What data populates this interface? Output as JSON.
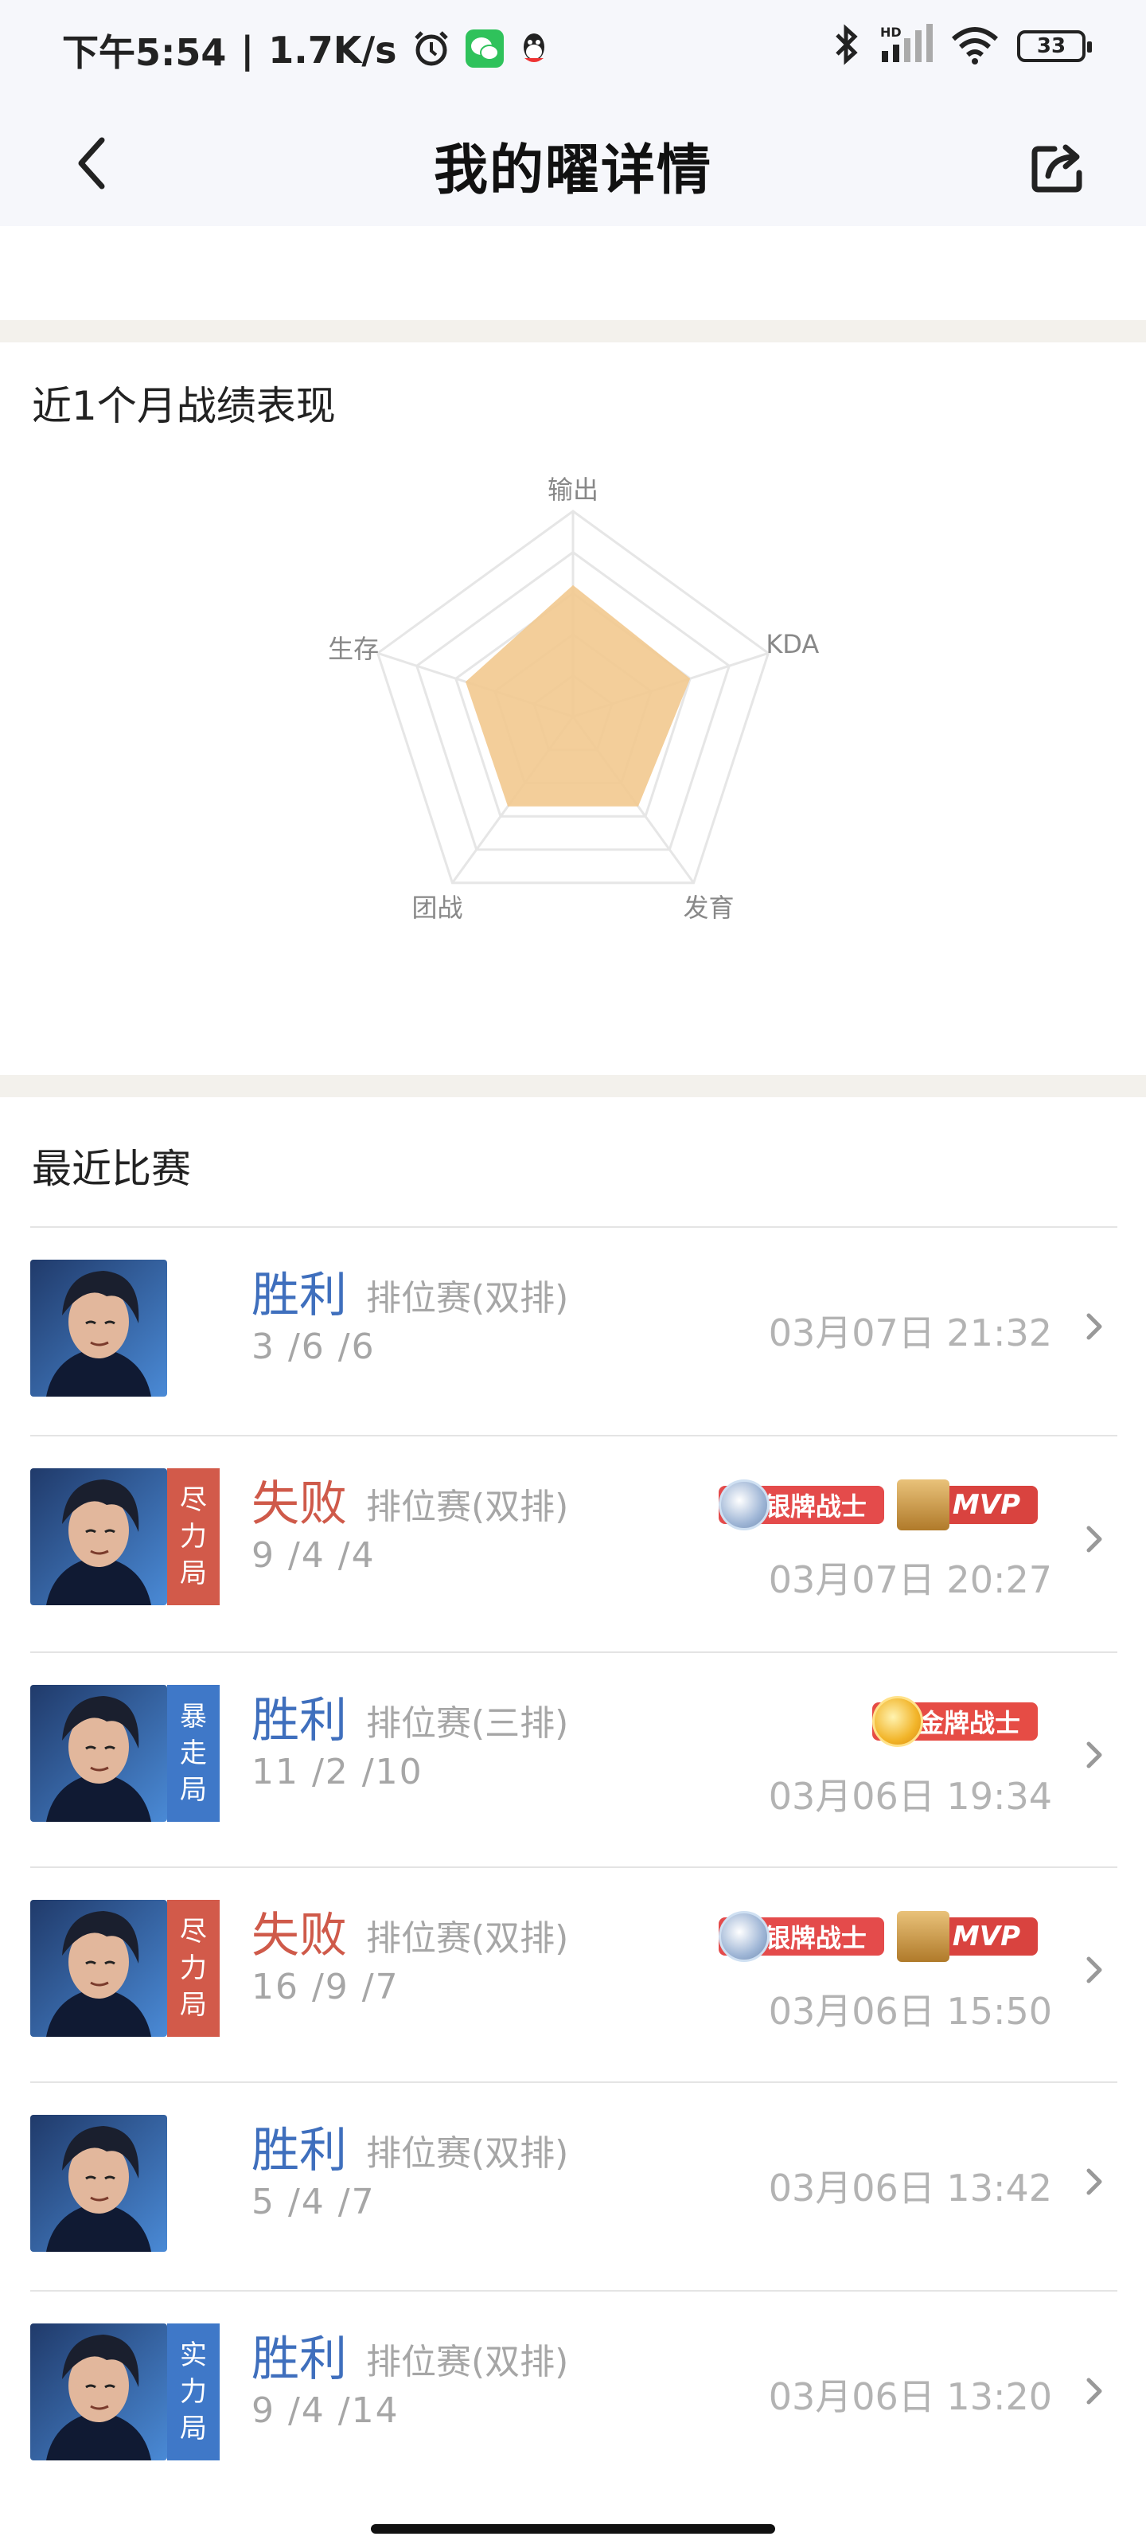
{
  "status": {
    "time": "下午5:54",
    "speed": "1.7K/s",
    "battery": "33",
    "network_badge": "HD",
    "icons": [
      "alarm-icon",
      "wechat-icon",
      "qq-icon",
      "bluetooth-icon",
      "signal-icon",
      "wifi-icon",
      "battery-icon"
    ]
  },
  "nav": {
    "title": "我的曜详情",
    "back_icon": "chevron-left-icon",
    "share_icon": "share-icon"
  },
  "performance": {
    "title": "近1个月战绩表现",
    "axes": [
      "输出",
      "KDA",
      "发育",
      "团战",
      "生存"
    ],
    "fill_color": "#f2c98f"
  },
  "chart_data": {
    "type": "radar",
    "axes": [
      "输出",
      "KDA",
      "发育",
      "团战",
      "生存"
    ],
    "values": [
      0.64,
      0.6,
      0.54,
      0.54,
      0.55
    ],
    "range": [
      0,
      1
    ],
    "grid_levels": 5
  },
  "recent": {
    "title": "最近比赛",
    "matches": [
      {
        "result": "胜利",
        "outcome": "win",
        "mode": "排位赛(双排)",
        "kda": "3 /6 /6",
        "datetime": "03月07日 21:32",
        "tag": "",
        "tag_color": "",
        "badges": []
      },
      {
        "result": "失败",
        "outcome": "lose",
        "mode": "排位赛(双排)",
        "kda": "9 /4 /4",
        "datetime": "03月07日 20:27",
        "tag": "尽力局",
        "tag_color": "red",
        "badges": [
          {
            "label": "银牌战士",
            "type": "silver"
          },
          {
            "label": "MVP",
            "type": "mvp"
          }
        ]
      },
      {
        "result": "胜利",
        "outcome": "win",
        "mode": "排位赛(三排)",
        "kda": "11 /2 /10",
        "datetime": "03月06日 19:34",
        "tag": "暴走局",
        "tag_color": "blue",
        "badges": [
          {
            "label": "金牌战士",
            "type": "gold"
          }
        ]
      },
      {
        "result": "失败",
        "outcome": "lose",
        "mode": "排位赛(双排)",
        "kda": "16 /9 /7",
        "datetime": "03月06日 15:50",
        "tag": "尽力局",
        "tag_color": "red",
        "badges": [
          {
            "label": "银牌战士",
            "type": "silver"
          },
          {
            "label": "MVP",
            "type": "mvp"
          }
        ]
      },
      {
        "result": "胜利",
        "outcome": "win",
        "mode": "排位赛(双排)",
        "kda": "5 /4 /7",
        "datetime": "03月06日 13:42",
        "tag": "",
        "tag_color": "",
        "badges": []
      },
      {
        "result": "胜利",
        "outcome": "win",
        "mode": "排位赛(双排)",
        "kda": "9 /4 /14",
        "datetime": "03月06日 13:20",
        "tag": "实力局",
        "tag_color": "blue",
        "badges": []
      }
    ]
  }
}
